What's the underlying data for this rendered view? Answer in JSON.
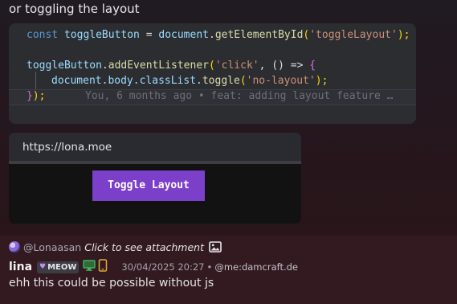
{
  "intro_text": "or toggling the layout",
  "code": {
    "line1": {
      "kw": "const",
      "var": "toggleButton",
      "eq": "=",
      "obj": "document",
      "method": "getElementById",
      "open": "(",
      "arg": "'toggleLayout'",
      "close": ");"
    },
    "line3": {
      "obj": "toggleButton",
      "method": "addEventListener",
      "open": "(",
      "arg": "'click'",
      "sep": ", () => ",
      "brace": "{"
    },
    "line4": {
      "obj": "document",
      "path": ".body.classList.",
      "method": "toggle",
      "open": "(",
      "arg": "'no-layout'",
      "close": ");"
    },
    "line5": {
      "brace": "}",
      "close": ");"
    },
    "blame": "You, 6 months ago • feat: adding layout feature …"
  },
  "preview": {
    "url": "https://lona.moe",
    "button_label": "Toggle Layout"
  },
  "reply": {
    "username": "@Lonaasan",
    "text": "Click to see attachment"
  },
  "message": {
    "author": "lina",
    "tag": "MEOW",
    "timestamp": "30/04/2025 20:27",
    "separator": "•",
    "handle": "@me:damcraft.de",
    "text": "ehh this could be possible without js"
  },
  "colors": {
    "button_bg": "#7b3fc9",
    "keyword": "#569cd6",
    "string": "#ce9178",
    "function": "#dcdcaa",
    "variable": "#9cdcfe"
  },
  "icons": {
    "reply_avatar": "avatar",
    "attachment": "image-icon",
    "tag_badge": "heart-icon",
    "desktop": "monitor-icon",
    "mobile": "phone-icon"
  }
}
